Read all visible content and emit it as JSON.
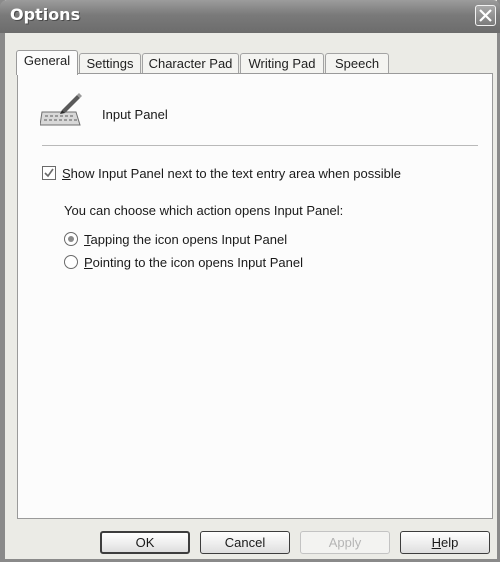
{
  "window": {
    "title": "Options"
  },
  "tabs": [
    {
      "label": "General",
      "active": true
    },
    {
      "label": "Settings",
      "active": false
    },
    {
      "label": "Character Pad",
      "active": false
    },
    {
      "label": "Writing Pad",
      "active": false
    },
    {
      "label": "Speech",
      "active": false
    }
  ],
  "panel": {
    "icon": "keyboard-pen-icon",
    "heading": "Input Panel",
    "show_checkbox": {
      "checked": true,
      "mnemonic": "S",
      "rest": "how Input Panel next to the text entry area when possible"
    },
    "choose_label": "You can choose which action opens Input Panel:",
    "radios": [
      {
        "mnemonic": "T",
        "rest": "apping the icon opens Input Panel",
        "selected": true
      },
      {
        "mnemonic": "P",
        "rest": "ointing to the icon opens Input Panel",
        "selected": false
      }
    ]
  },
  "buttons": {
    "ok": "OK",
    "cancel": "Cancel",
    "apply": "Apply",
    "help_mnemonic": "H",
    "help_rest": "elp"
  },
  "colors": {
    "titlebar": "#7a7a7a",
    "dialog_bg": "#ebebe6",
    "panel_bg": "#fcfcfc"
  }
}
